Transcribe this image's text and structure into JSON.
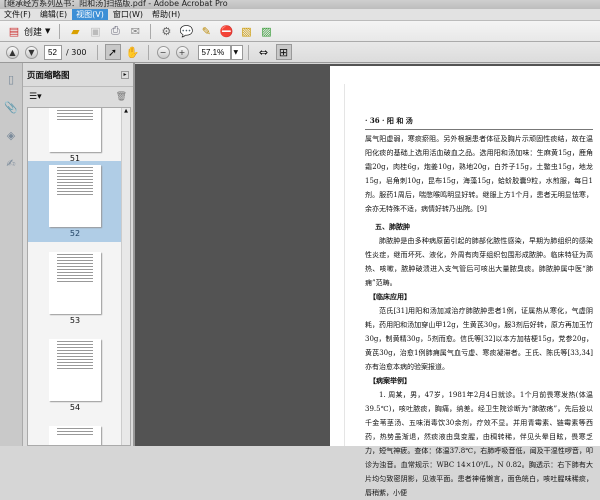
{
  "window": {
    "title": "[继承经方系列丛书：阳和汤]扫描版.pdf - Adobe Acrobat Pro"
  },
  "menu": [
    "文件(F)",
    "编辑(E)",
    "视图(V)",
    "窗口(W)",
    "帮助(H)"
  ],
  "toolbar": {
    "create_label": "创建"
  },
  "nav": {
    "page": "52",
    "total": "/ 300",
    "zoom": "57.1%"
  },
  "panel": {
    "title": "页面缩略图",
    "thumbnails": [
      "51",
      "52",
      "53",
      "54"
    ],
    "selected": "52"
  },
  "document": {
    "header": "· 36 ·  阳 和 汤",
    "para1": "属气阳虚弱，寒痰瘀阻。另外根据患者体征及胸片示顽固性痰结，故在温阳化痰的基础上选用活血破血之品。选用阳和汤加味：生麻黄15g，鹿角霜20g，肉桂6g，炮姜10g，熟地20g，白芥子15g，土鳖虫15g，地龙15g，皂角刺10g，昆布15g，海藻15g，蛤蚧胶囊9粒，水煎服，每日1剂。服药1周后，喘憋喉鸣明显好转。继服上方1个月，患者无明显怯寒，余亦无特殊不适，病情好转乃出院。[9]",
    "heading1": "五、肺脓肿",
    "para2": "肺脓肿是由多种病原菌引起的肺部化脓性感染，早期为肺组织的感染性炎症，继而坏死、液化，外周有肉芽组织包围形成脓肿。临床特征为高热、咳嗽，脓肿破溃进入支气管后可咳出大量脓臭痰。肺脓肿属中医“肺痈”范畴。",
    "heading2": "【临床应用】",
    "para3": "范氏[31]用阳和汤加减治疗肺脓肿患者1例，证属热从寒化，气虚阴耗，药用阳和汤加穿山甲12g，生黄芪30g，服3剂后好转，原方再加玉竹30g，制黄精30g，5剂而愈。信氏等[32]以本方加桔梗15g，党参20g，黄芪30g，治愈1例肺痈属气血亏虚、寒痰凝滞者。王氏、陈氏等[33,34]亦有治愈本病的验案报道。",
    "heading3": "【病案举例】",
    "para4": "1. 周某，男，47岁，1981年2月4日就诊。1个月前畏寒发热(体温39.5℃)，咳吐脓痰，胸痛，纳差。经卫生院诊断为“肺脓疡”，先后投以千金苇茎汤、五味消毒饮30余剂，疗效不显。并用青霉素、链霉素等西药，热势虽渐退，然痰液由臭变腥，由稠转稀，伴见头晕目眩，畏寒乏力，短气神疲。查体：体温37.8℃，右肺呼吸音低，闻及干湿性啰音，叩诊为浊音。血常规示：WBC 14×10⁹/L，N 0.82。胸透示：右下肺有大片均匀致密阴影，见液平面。患者神倦懒言，面色㿠白，咳吐腥味稀痰，唇稍紫，小便"
  }
}
